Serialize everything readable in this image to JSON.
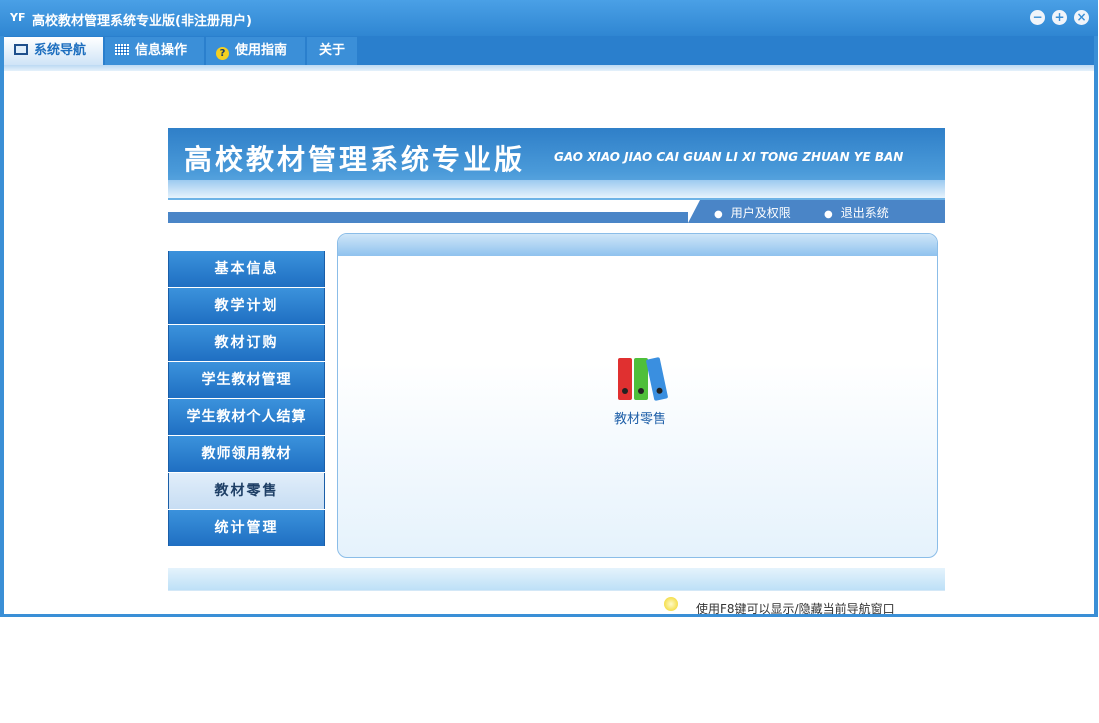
{
  "window": {
    "title": "高校教材管理系统专业版(非注册用户)",
    "app_icon": "YF",
    "controls": [
      "minimize-icon",
      "restore-icon",
      "close-icon"
    ]
  },
  "menubar": {
    "tabs": [
      {
        "label": "系统导航",
        "icon": "monitor-icon",
        "active": true
      },
      {
        "label": "信息操作",
        "icon": "grid-icon",
        "active": false
      },
      {
        "label": "使用指南",
        "icon": "help-icon",
        "active": false
      },
      {
        "label": "关于",
        "icon": "",
        "active": false
      }
    ]
  },
  "banner": {
    "title": "高校教材管理系统专业版",
    "subtitle": "GAO XIAO JIAO CAI GUAN LI XI TONG ZHUAN YE BAN"
  },
  "nav_links": [
    "用户及权限",
    "退出系统"
  ],
  "sidebar": {
    "items": [
      {
        "label": "基本信息",
        "active": false
      },
      {
        "label": "教学计划",
        "active": false
      },
      {
        "label": "教材订购",
        "active": false
      },
      {
        "label": "学生教材管理",
        "active": false
      },
      {
        "label": "学生教材个人结算",
        "active": false
      },
      {
        "label": "教师领用教材",
        "active": false
      },
      {
        "label": "教材零售",
        "active": true
      },
      {
        "label": "统计管理",
        "active": false
      }
    ]
  },
  "panel": {
    "module_label": "教材零售",
    "module_icon": "binders-icon"
  },
  "footer": {
    "hint": "使用F8键可以显示/隐藏当前导航窗口"
  },
  "colors": {
    "title_bar": "#3a8fd6",
    "menu_bar": "#2a7fcd",
    "sidebar_item": "#2a7fcd",
    "sidebar_active": "#d3e6f7",
    "binder_red": "#e03030",
    "binder_green": "#4fbf3a",
    "binder_blue": "#3a8fe0"
  }
}
